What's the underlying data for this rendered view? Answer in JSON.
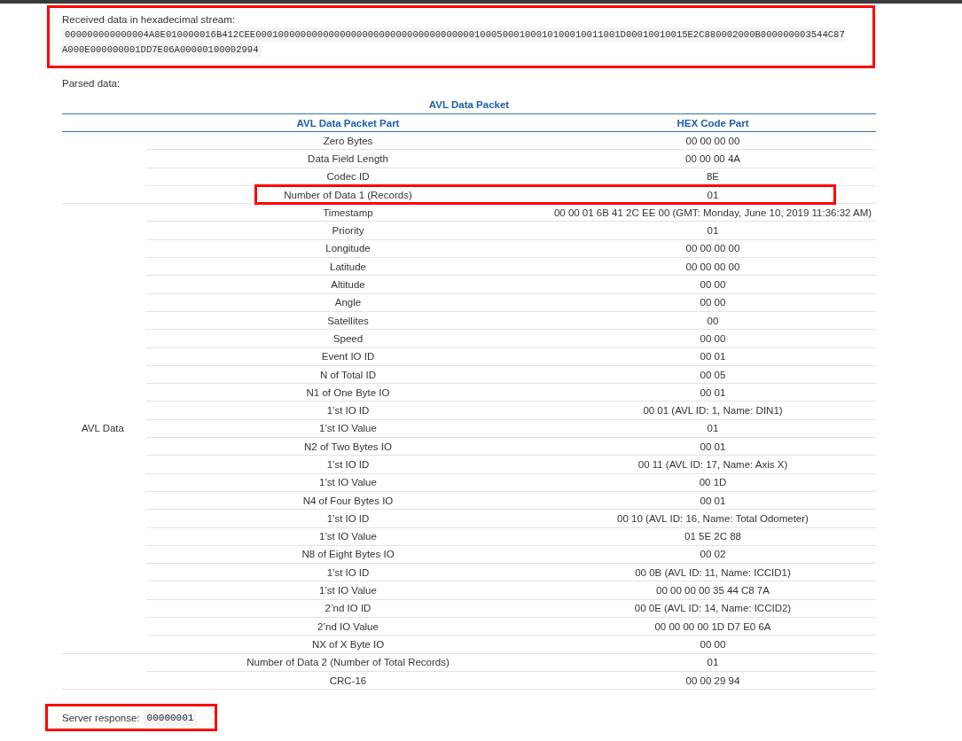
{
  "received": {
    "label": "Received data in hexadecimal stream:",
    "hex": "000000000000004A8E010000016B412CEE00010000000000000000000000000000000000010005000100010100010011001D00010010015E2C880002000B000000003544C87A000E000000001DD7E06A00000100002994",
    "highlighted": true
  },
  "parsed_label": "Parsed data:",
  "table": {
    "title": "AVL Data Packet",
    "columns": [
      "AVL Data Packet Part",
      "HEX Code Part"
    ],
    "groups": [
      {
        "rows": [
          {
            "part": "Zero Bytes",
            "hex": "00 00 00 00",
            "highlighted": false
          },
          {
            "part": "Data Field Length",
            "hex": "00 00 00 4A",
            "highlighted": false
          },
          {
            "part": "Codec ID",
            "hex": "8E",
            "highlighted": false
          },
          {
            "part": "Number of Data 1 (Records)",
            "hex": "01",
            "highlighted": true
          }
        ]
      },
      {
        "label": "AVL Data",
        "rows": [
          {
            "part": "Timestamp",
            "hex": "00 00 01 6B 41 2C EE 00 (GMT: Monday, June 10, 2019 11:36:32 AM)",
            "highlighted": false
          },
          {
            "part": "Priority",
            "hex": "01",
            "highlighted": false
          },
          {
            "part": "Longitude",
            "hex": "00 00 00 00",
            "highlighted": false
          },
          {
            "part": "Latitude",
            "hex": "00 00 00 00",
            "highlighted": false
          },
          {
            "part": "Altitude",
            "hex": "00 00",
            "highlighted": false
          },
          {
            "part": "Angle",
            "hex": "00 00",
            "highlighted": false
          },
          {
            "part": "Satellites",
            "hex": "00",
            "highlighted": false
          },
          {
            "part": "Speed",
            "hex": "00 00",
            "highlighted": false
          },
          {
            "part": "Event IO ID",
            "hex": "00 01",
            "highlighted": false
          },
          {
            "part": "N of Total ID",
            "hex": "00 05",
            "highlighted": false
          },
          {
            "part": "N1 of One Byte IO",
            "hex": "00 01",
            "highlighted": false
          },
          {
            "part": "1’st IO ID",
            "hex": "00 01 (AVL ID: 1, Name: DIN1)",
            "highlighted": false
          },
          {
            "part": "1’st IO Value",
            "hex": "01",
            "highlighted": false
          },
          {
            "part": "N2 of Two Bytes IO",
            "hex": "00 01",
            "highlighted": false
          },
          {
            "part": "1’st IO ID",
            "hex": "00 11 (AVL ID: 17, Name: Axis X)",
            "highlighted": false
          },
          {
            "part": "1’st IO Value",
            "hex": "00 1D",
            "highlighted": false
          },
          {
            "part": "N4 of Four Bytes IO",
            "hex": "00 01",
            "highlighted": false
          },
          {
            "part": "1’st IO ID",
            "hex": "00 10 (AVL ID: 16, Name: Total Odometer)",
            "highlighted": false
          },
          {
            "part": "1’st IO Value",
            "hex": "01 5E 2C 88",
            "highlighted": false
          },
          {
            "part": "N8 of Eight Bytes IO",
            "hex": "00 02",
            "highlighted": false
          },
          {
            "part": "1’st IO ID",
            "hex": "00 0B (AVL ID: 11, Name: ICCID1)",
            "highlighted": false
          },
          {
            "part": "1’st IO Value",
            "hex": "00 00 00 00 35 44 C8 7A",
            "highlighted": false
          },
          {
            "part": "2’nd IO ID",
            "hex": "00 0E (AVL ID: 14, Name: ICCID2)",
            "highlighted": false
          },
          {
            "part": "2’nd IO Value",
            "hex": "00 00 00 00 1D D7 E0 6A",
            "highlighted": false
          },
          {
            "part": "NX of X Byte IO",
            "hex": "00 00",
            "highlighted": false
          }
        ]
      },
      {
        "rows": [
          {
            "part": "Number of Data 2 (Number of Total Records)",
            "hex": "01",
            "highlighted": false
          },
          {
            "part": "CRC-16",
            "hex": "00 00 29 94",
            "highlighted": false
          }
        ]
      }
    ]
  },
  "server_response": {
    "label": "Server response:",
    "value": "00000001",
    "highlighted": true
  }
}
